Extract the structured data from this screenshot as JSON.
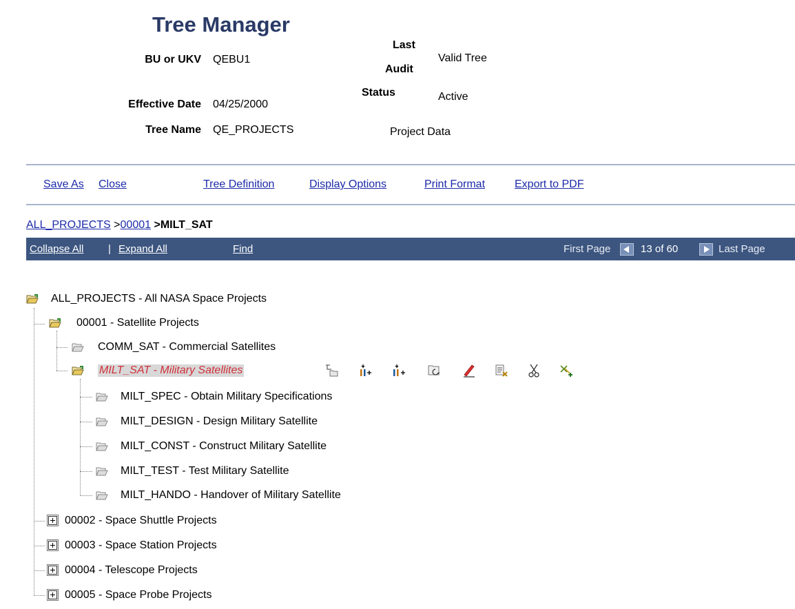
{
  "header": {
    "title": "Tree Manager",
    "bu_label": "BU or UKV",
    "bu_value": "QEBU1",
    "eff_date_label": "Effective Date",
    "eff_date_value": "04/25/2000",
    "tree_name_label": "Tree Name",
    "tree_name_value": "QE_PROJECTS",
    "tree_desc": "Project Data",
    "last_audit_label_1": "Last",
    "last_audit_label_2": "Audit",
    "last_audit_value": "Valid Tree",
    "status_label": "Status",
    "status_value": "Active"
  },
  "toolbar": {
    "save_as": "Save As",
    "close": "Close",
    "tree_definition": "Tree Definition",
    "display_options": "Display Options",
    "print_format": "Print Format",
    "export_pdf": "Export to PDF"
  },
  "breadcrumb": {
    "root": "ALL_PROJECTS",
    "sep1": ">",
    "level1": "00001",
    "sep2": ">",
    "current": "MILT_SAT"
  },
  "navbar": {
    "collapse_all": "Collapse All",
    "separator": "|",
    "expand_all": "Expand All",
    "find": "Find",
    "first_page": "First Page",
    "page_status": "13 of 60",
    "last_page": "Last Page"
  },
  "tree": {
    "root": "ALL_PROJECTS - All NASA Space Projects",
    "n00001": "00001 - Satellite Projects",
    "comm_sat": "COMM_SAT - Commercial Satellites",
    "milt_sat": "MILT_SAT - Military Satellites",
    "milt_spec": "MILT_SPEC - Obtain Military Specifications",
    "milt_design": "MILT_DESIGN - Design Military Satellite",
    "milt_const": "MILT_CONST - Construct Military Satellite",
    "milt_test": "MILT_TEST - Test Military Satellite",
    "milt_hando": "MILT_HANDO - Handover of Military Satellite",
    "n00002": "00002 - Space Shuttle Projects",
    "n00003": "00003 - Space Station Projects",
    "n00004": "00004 - Telescope Projects",
    "n00005": "00005 - Space Probe Projects"
  },
  "node_actions": [
    "insert-sibling-node-icon",
    "insert-child-node-icon",
    "insert-sibling-node-alt-icon",
    "insert-detail-icon",
    "edit-node-icon",
    "delete-node-icon",
    "cut-icon",
    "paste-icon"
  ],
  "colors": {
    "link": "#1c2aa8",
    "bar": "#3d5680",
    "title": "#2a3a66",
    "selected_text": "#d0303a"
  }
}
